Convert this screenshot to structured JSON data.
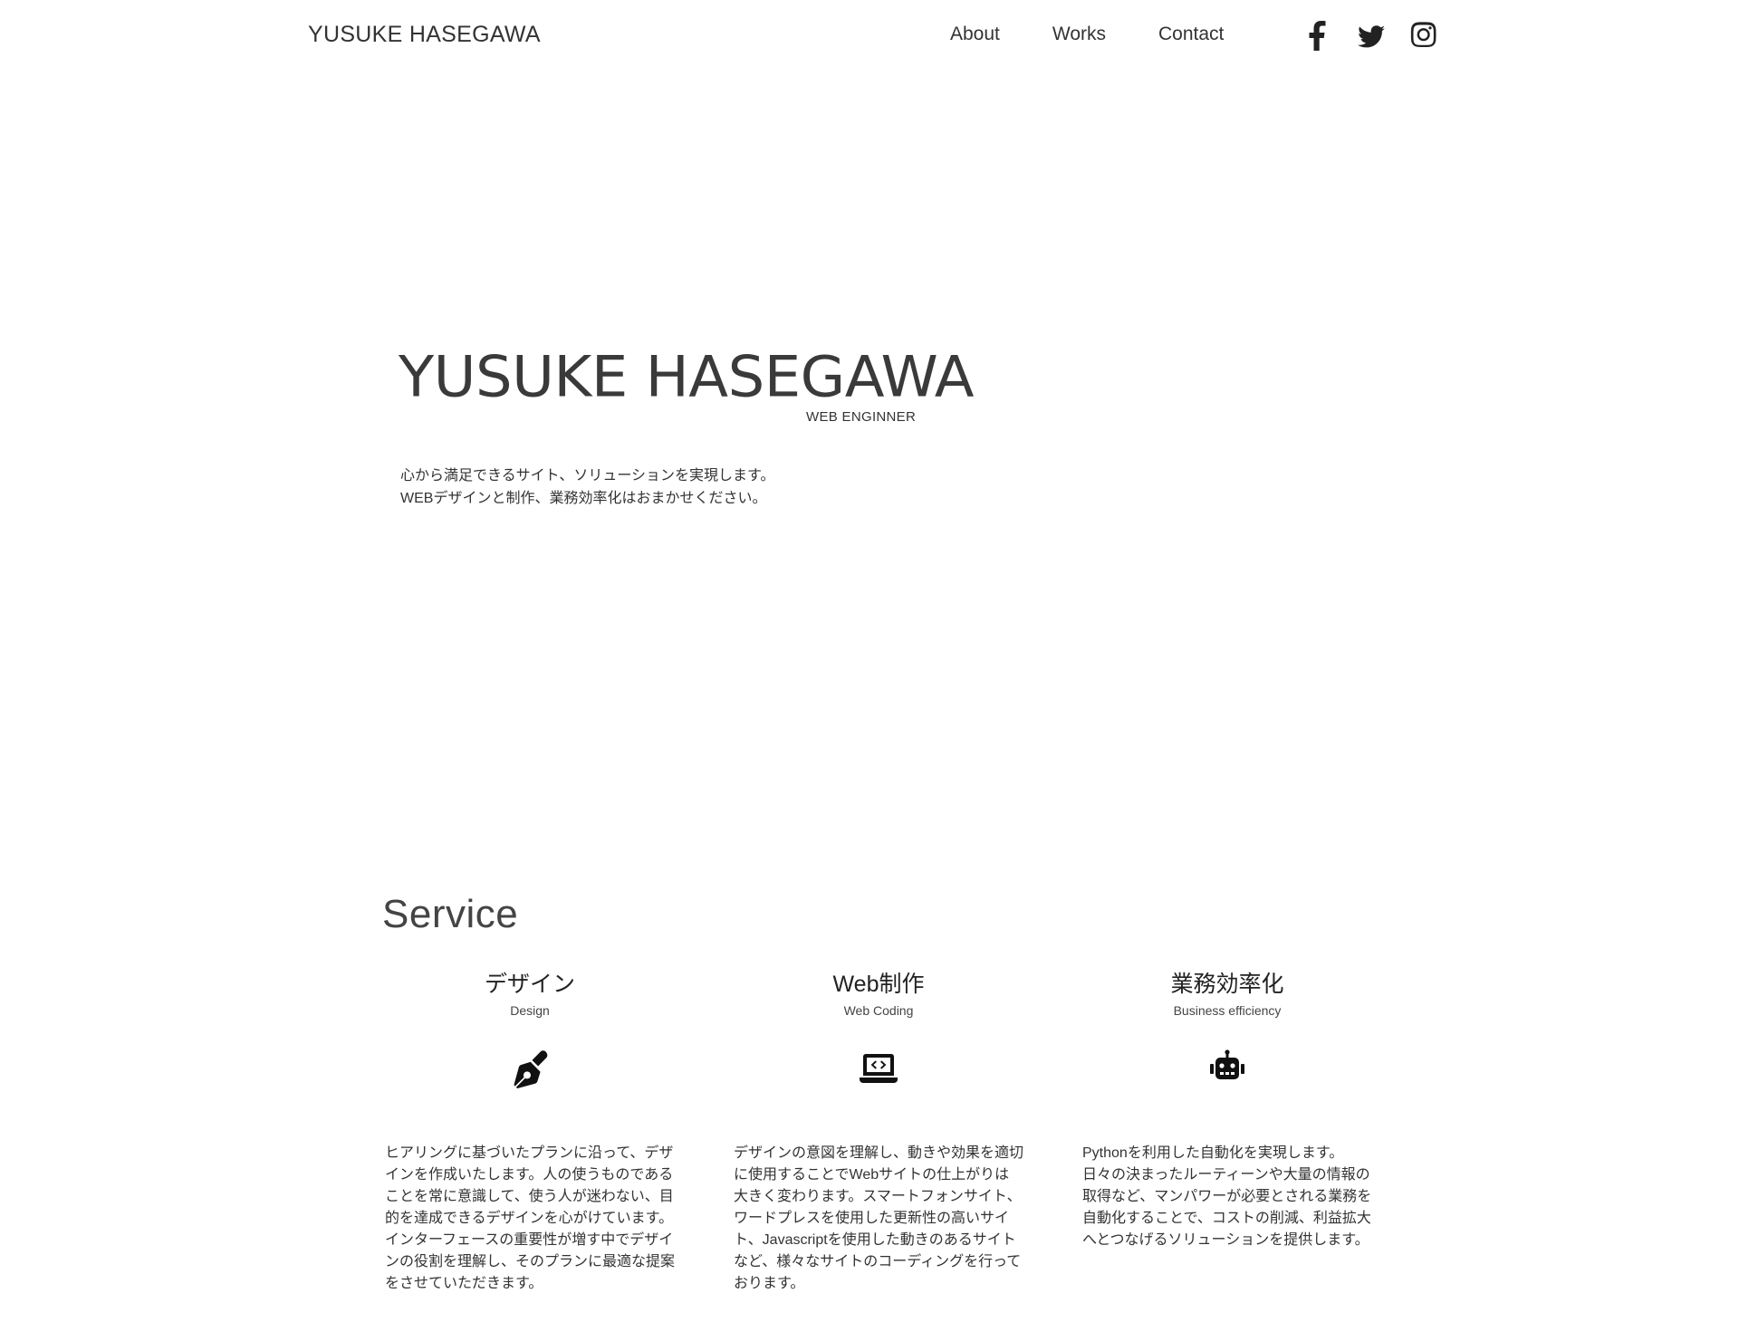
{
  "header": {
    "brand": "YUSUKE HASEGAWA",
    "nav": [
      "About",
      "Works",
      "Contact"
    ],
    "social": [
      {
        "name": "facebook",
        "icon": "facebook-icon"
      },
      {
        "name": "twitter",
        "icon": "twitter-icon"
      },
      {
        "name": "instagram",
        "icon": "instagram-icon"
      }
    ]
  },
  "hero": {
    "name": "YUSUKE HASEGAWA",
    "role": "WEB ENGINNER",
    "lead": [
      "心から満足できるサイト、ソリューションを実現します。",
      "WEBデザインと制作、業務効率化はおまかせください。"
    ]
  },
  "service": {
    "title": "Service",
    "cards": [
      {
        "title": "デザイン",
        "subtitle": "Design",
        "icon": "pen-nib-icon",
        "text": [
          "ヒアリングに基づいたプランに沿って、デザ",
          "インを作成いたします。人の使うものである",
          "ことを常に意識して、使う人が迷わない、目",
          "的を達成できるデザインを心がけています。",
          "インターフェースの重要性が増す中でデザイ",
          "ンの役割を理解し、そのプランに最適な提案",
          "をさせていただきます。"
        ]
      },
      {
        "title": "Web制作",
        "subtitle": "Web Coding",
        "icon": "laptop-code-icon",
        "text": [
          "デザインの意図を理解し、動きや効果を適切",
          "に使用することでWebサイトの仕上がりは",
          "大きく変わります。スマートフォンサイト、",
          "ワードプレスを使用した更新性の高いサイ",
          "ト、Javascriptを使用した動きのあるサイト",
          "など、様々なサイトのコーディングを行って",
          "おります。"
        ]
      },
      {
        "title": "業務効率化",
        "subtitle": "Business efficiency",
        "icon": "robot-icon",
        "text": [
          "Pythonを利用した自動化を実現します。",
          "日々の決まったルーティーンや大量の情報の",
          "取得など、マンパワーが必要とされる業務を",
          "自動化することで、コストの削減、利益拡大",
          "へとつなげるソリューションを提供します。"
        ]
      }
    ]
  }
}
